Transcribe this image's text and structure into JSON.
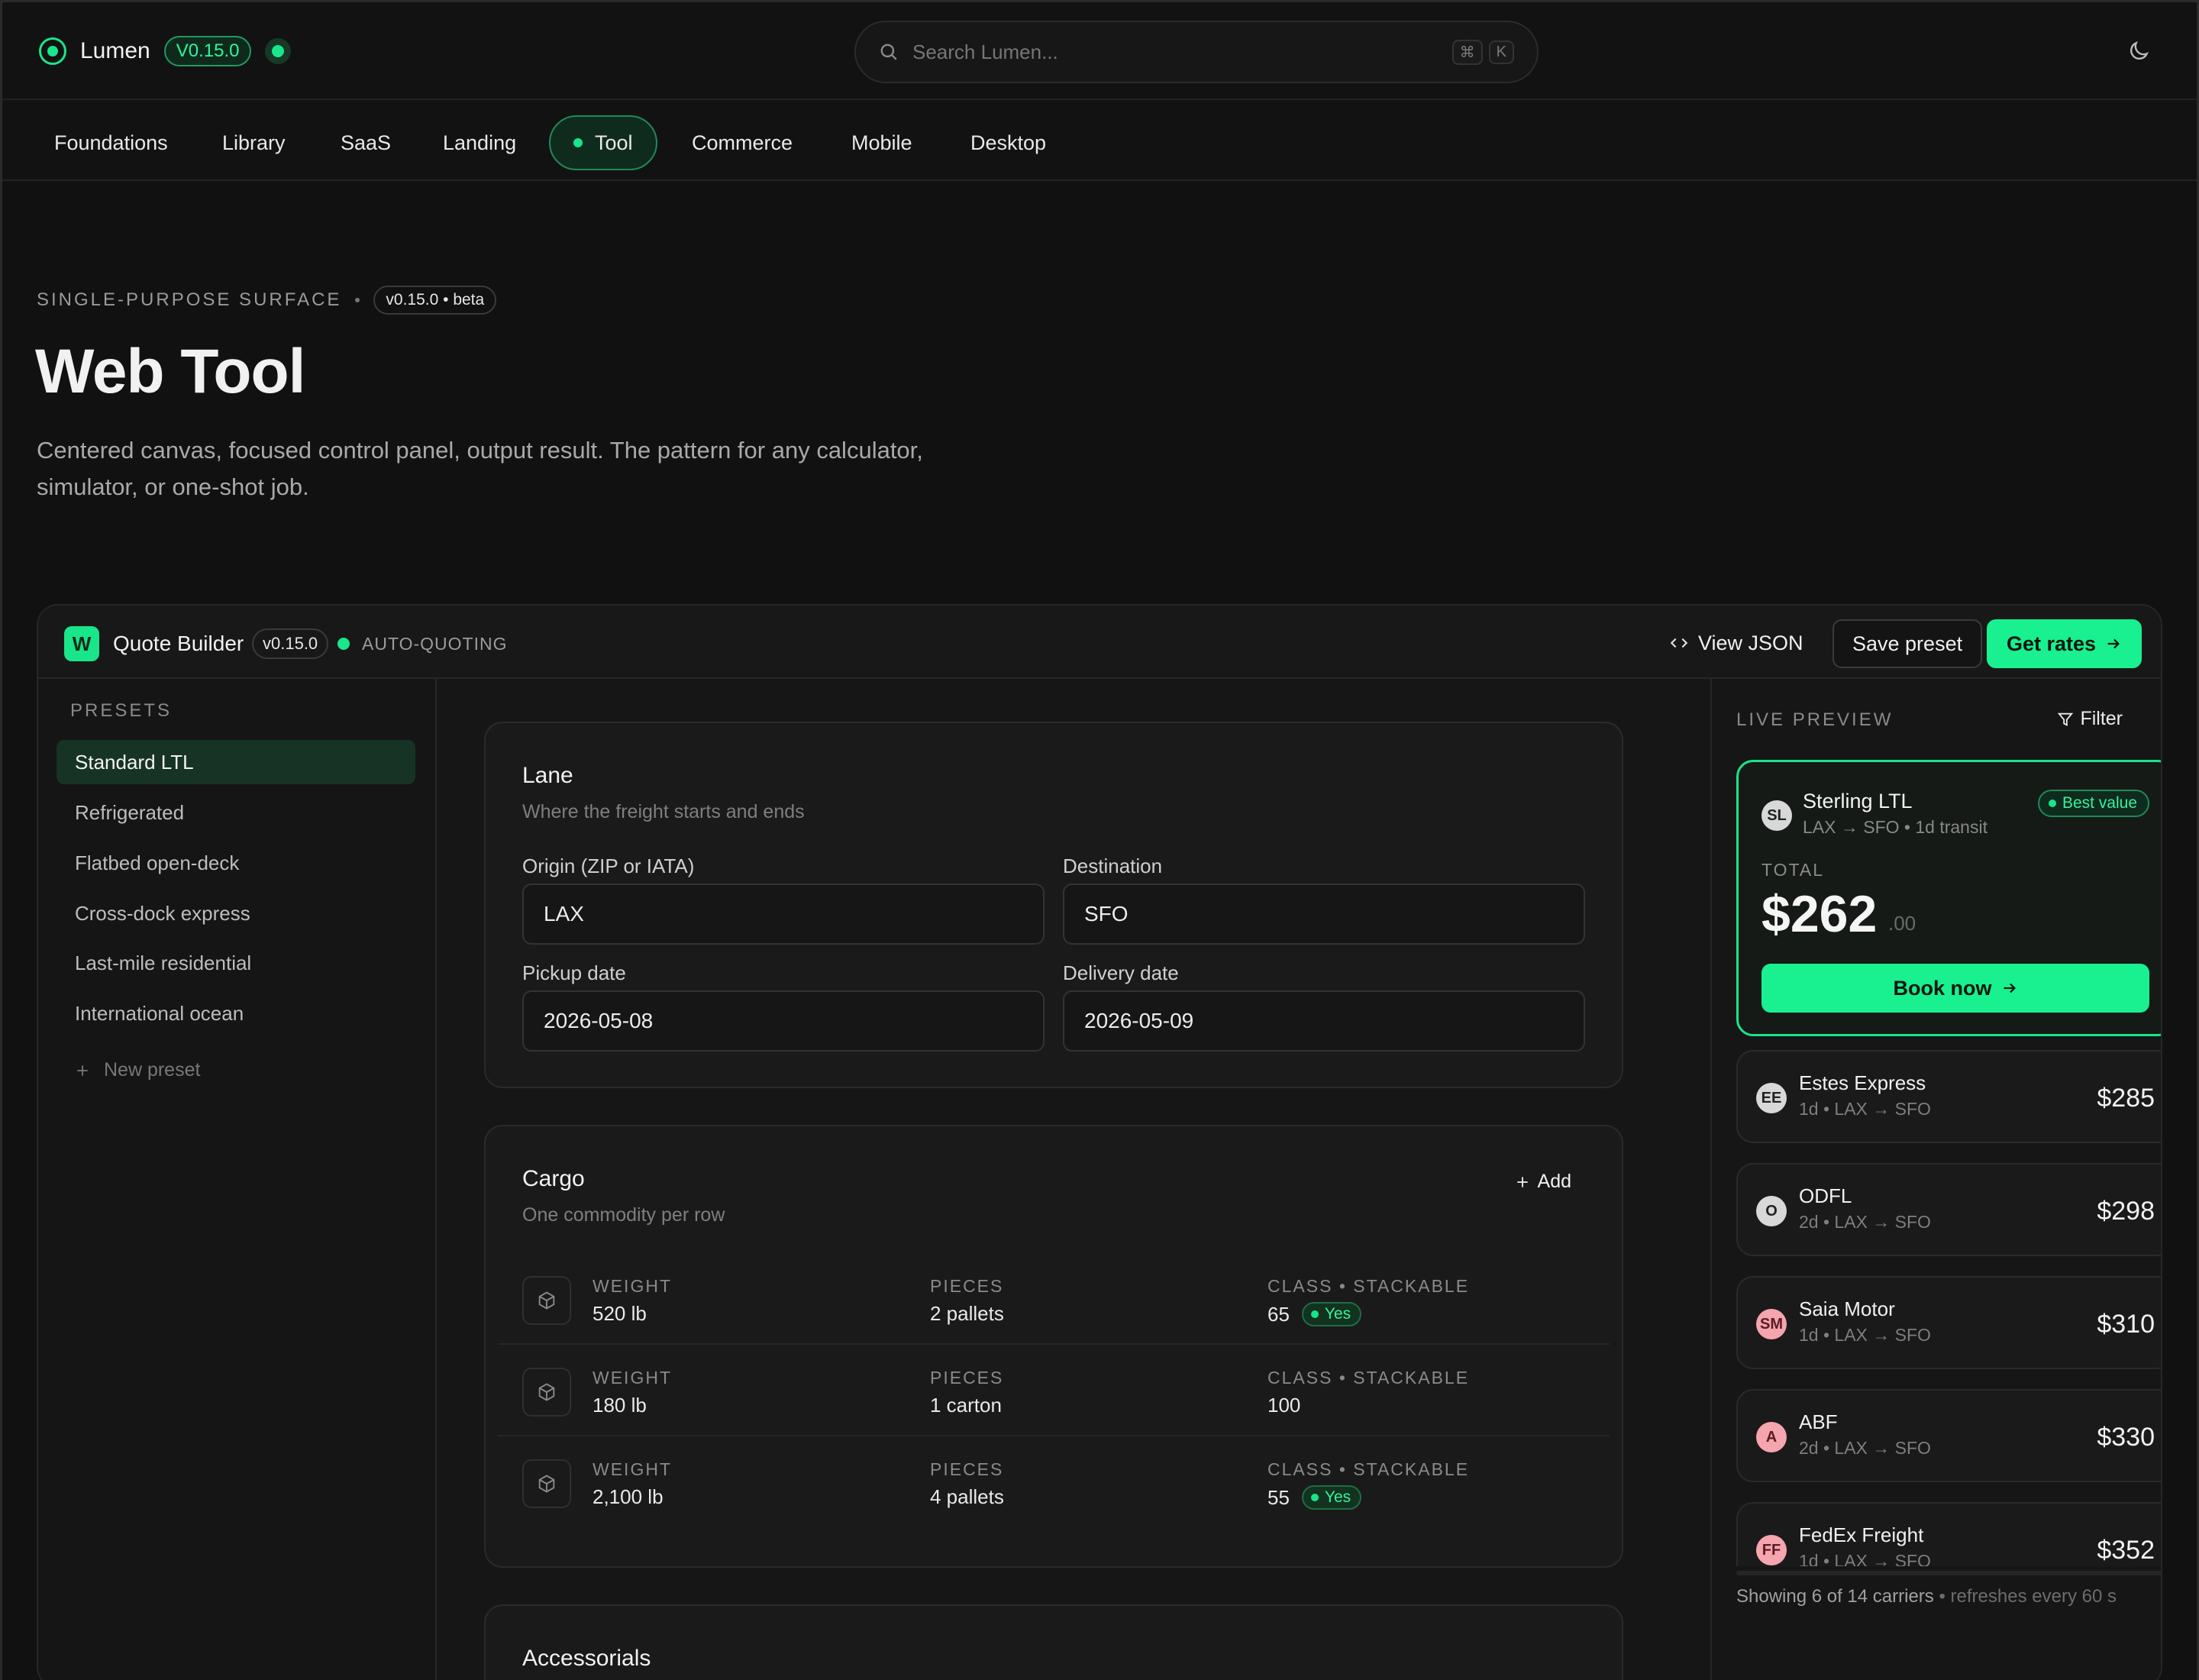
{
  "topbar": {
    "brand": "Lumen",
    "version": "V0.15.0",
    "search_placeholder": "Search Lumen...",
    "kbd": [
      "⌘",
      "K"
    ]
  },
  "nav": {
    "items": [
      {
        "label": "Foundations",
        "active": false
      },
      {
        "label": "Library",
        "active": false
      },
      {
        "label": "SaaS",
        "active": false
      },
      {
        "label": "Landing",
        "active": false
      },
      {
        "label": "Tool",
        "active": true
      },
      {
        "label": "Commerce",
        "active": false
      },
      {
        "label": "Mobile",
        "active": false
      },
      {
        "label": "Desktop",
        "active": false
      }
    ]
  },
  "hero": {
    "eyebrow": "SINGLE-PURPOSE SURFACE",
    "badge": "v0.15.0 • beta",
    "title": "Web Tool",
    "subtitle": "Centered canvas, focused control panel, output result. The pattern for any calculator, simulator, or one-shot job."
  },
  "app": {
    "logo_letter": "W",
    "name": "Quote Builder",
    "version": "v0.15.0",
    "status": "AUTO-QUOTING",
    "view_json": "View JSON",
    "save_preset": "Save preset",
    "get_rates": "Get rates",
    "accent": "#19f08f"
  },
  "sidebar": {
    "label": "PRESETS",
    "items": [
      {
        "label": "Standard LTL",
        "active": true
      },
      {
        "label": "Refrigerated",
        "active": false
      },
      {
        "label": "Flatbed open-deck",
        "active": false
      },
      {
        "label": "Cross-dock express",
        "active": false
      },
      {
        "label": "Last-mile residential",
        "active": false
      },
      {
        "label": "International ocean",
        "active": false
      }
    ],
    "new_preset": "New preset"
  },
  "lane": {
    "title": "Lane",
    "subtitle": "Where the freight starts and ends",
    "origin_label": "Origin (ZIP or IATA)",
    "origin_value": "LAX",
    "destination_label": "Destination",
    "destination_value": "SFO",
    "pickup_label": "Pickup date",
    "pickup_value": "2026-05-08",
    "delivery_label": "Delivery date",
    "delivery_value": "2026-05-09"
  },
  "cargo": {
    "title": "Cargo",
    "subtitle": "One commodity per row",
    "add_label": "Add",
    "col_weight": "WEIGHT",
    "col_pieces": "PIECES",
    "col_class": "CLASS • STACKABLE",
    "rows": [
      {
        "weight": "520 lb",
        "pieces": "2 pallets",
        "class": "65",
        "stackable": "Yes"
      },
      {
        "weight": "180 lb",
        "pieces": "1 carton",
        "class": "100",
        "stackable": ""
      },
      {
        "weight": "2,100 lb",
        "pieces": "4 pallets",
        "class": "55",
        "stackable": "Yes"
      }
    ]
  },
  "accessorials": {
    "title": "Accessorials"
  },
  "preview": {
    "label": "LIVE PREVIEW",
    "filter": "Filter",
    "best": {
      "initials": "SL",
      "name": "Sterling LTL",
      "meta": "LAX → SFO • 1d transit",
      "badge": "Best value",
      "total_label": "TOTAL",
      "price": "$262",
      "cents": ".00",
      "cta": "Book now"
    },
    "carriers": [
      {
        "initials": "EE",
        "name": "Estes Express",
        "meta": "1d • LAX → SFO",
        "price": "$285",
        "tone": "grey"
      },
      {
        "initials": "O",
        "name": "ODFL",
        "meta": "2d • LAX → SFO",
        "price": "$298",
        "tone": "grey"
      },
      {
        "initials": "SM",
        "name": "Saia Motor",
        "meta": "1d • LAX → SFO",
        "price": "$310",
        "tone": "pink"
      },
      {
        "initials": "A",
        "name": "ABF",
        "meta": "2d • LAX → SFO",
        "price": "$330",
        "tone": "pink"
      },
      {
        "initials": "FF",
        "name": "FedEx Freight",
        "meta": "1d • LAX → SFO",
        "price": "$352",
        "tone": "pink"
      }
    ],
    "footer_main": "Showing 6 of 14 carriers",
    "footer_muted": "• refreshes every 60 s"
  }
}
